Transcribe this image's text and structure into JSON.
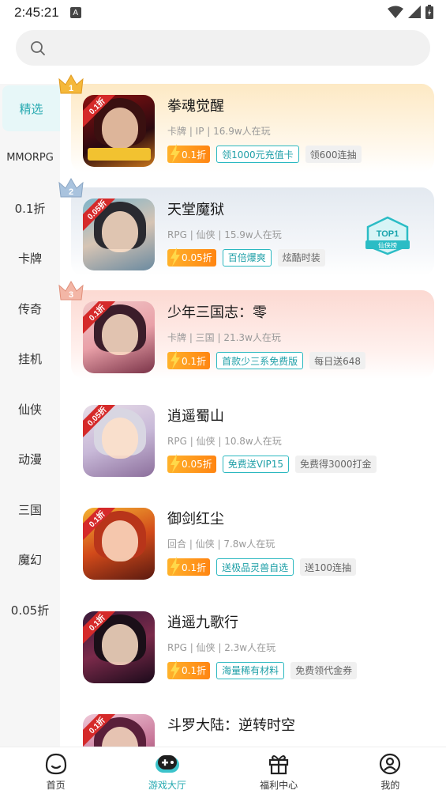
{
  "status_bar": {
    "time": "2:45:21",
    "indicator": "A"
  },
  "search": {
    "placeholder": ""
  },
  "sidebar": {
    "items": [
      {
        "label": "精选",
        "active": true
      },
      {
        "label": "MMORPG"
      },
      {
        "label": "0.1折"
      },
      {
        "label": "卡牌"
      },
      {
        "label": "传奇"
      },
      {
        "label": "挂机"
      },
      {
        "label": "仙侠"
      },
      {
        "label": "动漫"
      },
      {
        "label": "三国"
      },
      {
        "label": "魔幻"
      },
      {
        "label": "0.05折"
      }
    ]
  },
  "games": [
    {
      "rank": "1",
      "name": "拳魂觉醒",
      "meta": "卡牌 | IP | 16.9w人在玩",
      "discount": "0.1折",
      "thumb_disc": "0.1折",
      "hot": "领1000元充值卡",
      "extra": "领600连抽"
    },
    {
      "rank": "2",
      "name": "天堂魔狱",
      "meta": "RPG | 仙侠 | 15.9w人在玩",
      "discount": "0.05折",
      "thumb_disc": "0.05折",
      "hot": "百倍爆爽",
      "extra": "炫酷时装",
      "badge": {
        "title": "TOP1",
        "sub": "仙侠榜"
      }
    },
    {
      "rank": "3",
      "name": "少年三国志：零",
      "meta": "卡牌 | 三国 | 21.3w人在玩",
      "discount": "0.1折",
      "thumb_disc": "0.1折",
      "hot": "首款少三系免费版",
      "extra": "每日送648"
    },
    {
      "name": "逍遥蜀山",
      "meta": "RPG | 仙侠 | 10.8w人在玩",
      "discount": "0.05折",
      "thumb_disc": "0.05折",
      "hot": "免费送VIP15",
      "extra": "免费得3000打金"
    },
    {
      "name": "御剑红尘",
      "meta": "回合 | 仙侠 | 7.8w人在玩",
      "discount": "0.1折",
      "thumb_disc": "0.1折",
      "hot": "送极品灵兽自选",
      "extra": "送100连抽"
    },
    {
      "name": "逍遥九歌行",
      "meta": "RPG | 仙侠 | 2.3w人在玩",
      "discount": "0.1折",
      "thumb_disc": "0.1折",
      "hot": "海量稀有材料",
      "extra": "免费领代金券"
    },
    {
      "name": "斗罗大陆：逆转时空",
      "meta": "",
      "discount": "",
      "thumb_disc": "0.1折",
      "hot": "",
      "extra": ""
    }
  ],
  "bottom_nav": [
    {
      "label": "首页",
      "icon": "home-icon"
    },
    {
      "label": "游戏大厅",
      "icon": "gamepad-icon",
      "active": true
    },
    {
      "label": "福利中心",
      "icon": "gift-icon"
    },
    {
      "label": "我的",
      "icon": "profile-icon"
    }
  ],
  "colors": {
    "accent": "#26a9b0",
    "discount_orange": "#ff8d14",
    "thumb_red": "#d52a2a"
  }
}
